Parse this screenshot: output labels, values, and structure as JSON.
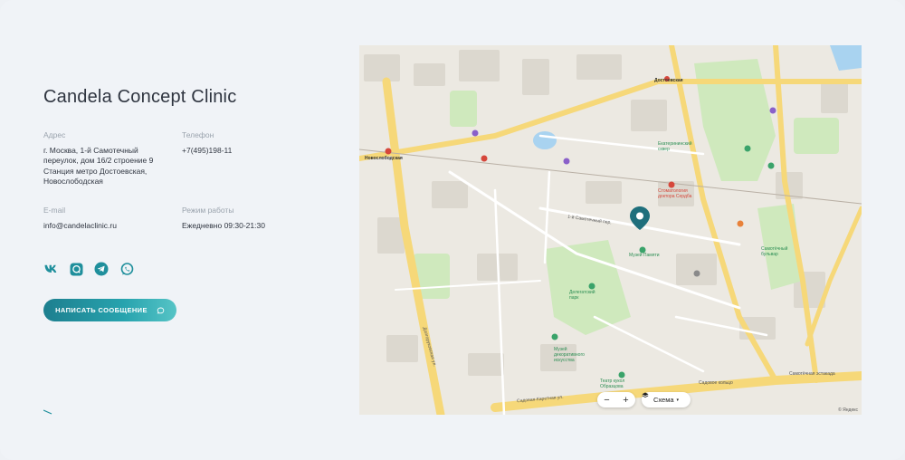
{
  "clinic": {
    "title": "Candela Concept Clinic"
  },
  "contacts": {
    "address_label": "Адрес",
    "address_value": "г. Москва, 1-й Самотечный\nпереулок, дом 16/2 строение 9\nСтанция метро Достоевская,\nНовослободская",
    "phone_label": "Телефон",
    "phone_value": "+7(495)198-11",
    "email_label": "E-mail",
    "email_value": "info@candelaclinic.ru",
    "hours_label": "Режим работы",
    "hours_value": "Ежедневно 09:30-21:30"
  },
  "socials": [
    {
      "icon": "vk-icon"
    },
    {
      "icon": "chat-icon"
    },
    {
      "icon": "telegram-icon"
    },
    {
      "icon": "whatsapp-icon"
    }
  ],
  "cta": {
    "label": "НАПИСАТЬ СООБЩЕНИЕ"
  },
  "colors": {
    "accent": "#1f8f9c",
    "map_marker": "#1f6f7c",
    "park": "#c9e6b5",
    "road": "#f8d77a"
  },
  "map": {
    "labels": {
      "dostoevskaya": "Достоевская",
      "novoslobodskaya": "Новослободская",
      "muzey_pamyati": "Музей Памяти",
      "delegatsky_park": "Делегатский парк",
      "sadovoe": "Садовая-Каретная ул.",
      "samotechnaya": "Самотёчная эстакада",
      "dolgorukovskaya": "Долгоруковская ул.",
      "samotechny_pereulok": "1-й Самотечный пер.",
      "samotechny_bulvar": "Самотёчный бульвар",
      "teatr_kukol": "Театр кукол Образцова",
      "ekaterininsky": "Екатерининский сквер",
      "sadovoe_koltso": "Садовое кольцо",
      "stomatologia": "Стоматология доктора Сердба",
      "muzey_dekorativnogo": "Музей декоративного искусства"
    },
    "layer_label": "Схема",
    "zoom_in": "+",
    "zoom_out": "−",
    "copyright": "© Яндекс"
  }
}
